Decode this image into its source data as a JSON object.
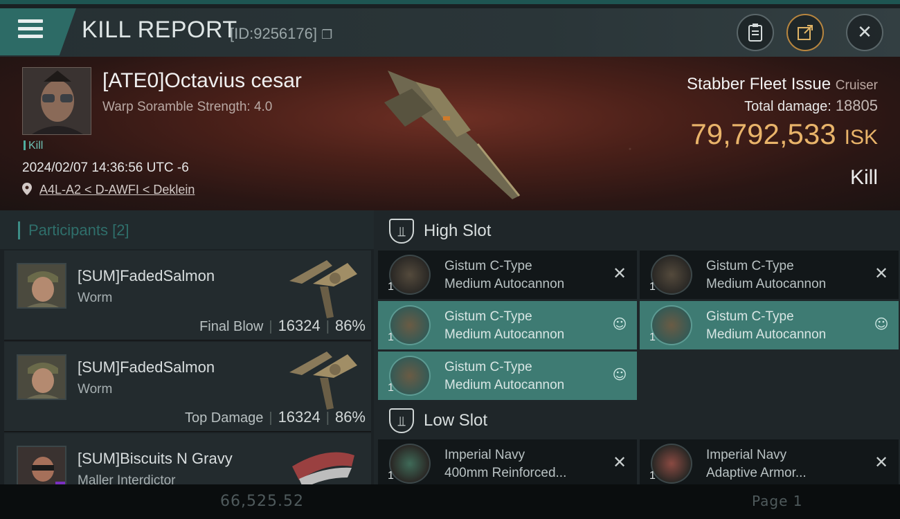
{
  "header": {
    "title": "KILL REPORT",
    "report_id": "[ID:9256176]"
  },
  "victim": {
    "name": "[ATE0]Octavius cesar",
    "subtitle": "Warp Soramble Strength: 4.0",
    "tag": "Kill",
    "time": "2024/02/07 14:36:56 UTC -6",
    "location": "A4L-A2 < D-AWFI < Deklein",
    "ship": "Stabber Fleet Issue",
    "ship_class": "Cruiser",
    "total_damage_label": "Total damage:",
    "total_damage": "18805",
    "isk_value": "79,792,533",
    "isk_unit": "ISK",
    "result": "Kill"
  },
  "participants": {
    "title": "Participants",
    "count": "[2]",
    "list": [
      {
        "name": "[SUM]FadedSalmon",
        "ship": "Worm",
        "role": "Final Blow",
        "damage": "16324",
        "percent": "86%"
      },
      {
        "name": "[SUM]FadedSalmon",
        "ship": "Worm",
        "role": "Top Damage",
        "damage": "16324",
        "percent": "86%"
      },
      {
        "name": "[SUM]Biscuits N Gravy",
        "ship": "Maller Interdictor",
        "role": "",
        "damage": "",
        "percent": ""
      }
    ]
  },
  "fitting": {
    "high_slot_label": "High Slot",
    "low_slot_label": "Low Slot",
    "high_modules": [
      {
        "line1": "Gistum C-Type",
        "line2": "Medium Autocannon",
        "qty": "1",
        "state": "destroyed"
      },
      {
        "line1": "Gistum C-Type",
        "line2": "Medium Autocannon",
        "qty": "1",
        "state": "destroyed"
      },
      {
        "line1": "Gistum C-Type",
        "line2": "Medium Autocannon",
        "qty": "1",
        "state": "dropped"
      },
      {
        "line1": "Gistum C-Type",
        "line2": "Medium Autocannon",
        "qty": "1",
        "state": "dropped"
      },
      {
        "line1": "Gistum C-Type",
        "line2": "Medium Autocannon",
        "qty": "1",
        "state": "dropped"
      }
    ],
    "low_modules": [
      {
        "line1": "Imperial Navy",
        "line2": "400mm Reinforced...",
        "qty": "1",
        "state": "destroyed"
      },
      {
        "line1": "Imperial Navy",
        "line2": "Adaptive Armor...",
        "qty": "1",
        "state": "destroyed"
      }
    ]
  },
  "footer": {
    "ghost_value": "66,525.52",
    "ghost_page": "Page 1"
  },
  "icons": {
    "menu": "hamburger-menu-icon",
    "clipboard": "clipboard-icon",
    "share": "share-icon",
    "close": "close-icon",
    "copy": "copy-icon",
    "location": "map-pin-icon",
    "slot": "slot-shield-icon",
    "destroyed": "x-mark-icon",
    "dropped": "person-icon"
  },
  "colors": {
    "accent": "#3e7b73",
    "isk": "#e9b46a",
    "header_tab": "#2d6b66"
  }
}
